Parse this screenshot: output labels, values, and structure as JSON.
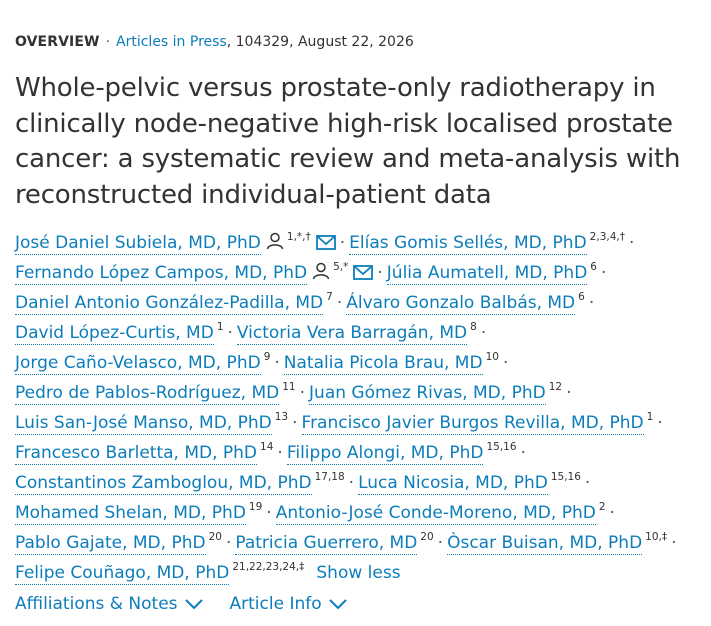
{
  "header": {
    "overview": "OVERVIEW",
    "journal": "Articles in Press",
    "details": ", 104329, August 22, 2026"
  },
  "title": "Whole-pelvic versus prostate-only radiotherapy in clinically node-negative high-risk localised prostate cancer: a systematic review and meta-analysis with reconstructed individual-patient data",
  "authors": {
    "a1": {
      "name": "José Daniel Subiela, MD, PhD",
      "sup": "1,*,†"
    },
    "a2": {
      "name": "Elías Gomis Sellés, MD, PhD",
      "sup": "2,3,4,†"
    },
    "a3": {
      "name": "Fernando López Campos, MD, PhD",
      "sup": "5,*"
    },
    "a4": {
      "name": "Júlia Aumatell, MD, PhD",
      "sup": "6"
    },
    "a5": {
      "name": "Daniel Antonio González-Padilla, MD",
      "sup": "7"
    },
    "a6": {
      "name": "Álvaro Gonzalo Balbás, MD",
      "sup": "6"
    },
    "a7": {
      "name": "David López-Curtis, MD",
      "sup": "1"
    },
    "a8": {
      "name": "Victoria Vera Barragán, MD",
      "sup": "8"
    },
    "a9": {
      "name": "Jorge Caño-Velasco, MD, PhD",
      "sup": "9"
    },
    "a10": {
      "name": "Natalia Picola Brau, MD",
      "sup": "10"
    },
    "a11": {
      "name": "Pedro de Pablos-Rodríguez, MD",
      "sup": "11"
    },
    "a12": {
      "name": "Juan Gómez Rivas, MD, PhD",
      "sup": "12"
    },
    "a13": {
      "name": "Luis San-José Manso, MD, PhD",
      "sup": "13"
    },
    "a14": {
      "name": "Francisco Javier Burgos Revilla, MD, PhD",
      "sup": "1"
    },
    "a15": {
      "name": "Francesco Barletta, MD, PhD",
      "sup": "14"
    },
    "a16": {
      "name": "Filippo Alongi, MD, PhD",
      "sup": "15,16"
    },
    "a17": {
      "name": "Constantinos Zamboglou, MD, PhD",
      "sup": "17,18"
    },
    "a18": {
      "name": "Luca Nicosia, MD, PhD",
      "sup": "15,16"
    },
    "a19": {
      "name": "Mohamed Shelan, MD, PhD",
      "sup": "19"
    },
    "a20": {
      "name": "Antonio-José Conde-Moreno, MD, PhD",
      "sup": "2"
    },
    "a21": {
      "name": "Pablo Gajate, MD, PhD",
      "sup": "20"
    },
    "a22": {
      "name": "Patricia Guerrero, MD",
      "sup": "20"
    },
    "a23": {
      "name": "Òscar Buisan, MD, PhD",
      "sup": "10,‡"
    },
    "a24": {
      "name": "Felipe Couñago, MD, PhD",
      "sup": "21,22,23,24,‡"
    }
  },
  "separator": "·",
  "show_less": "Show less",
  "footer": {
    "affiliations": "Affiliations & Notes",
    "article_info": "Article Info"
  },
  "colors": {
    "link": "#0c7dbb",
    "text": "#333333"
  },
  "icons": [
    "person-icon",
    "envelope-icon",
    "chevron-down-icon"
  ]
}
